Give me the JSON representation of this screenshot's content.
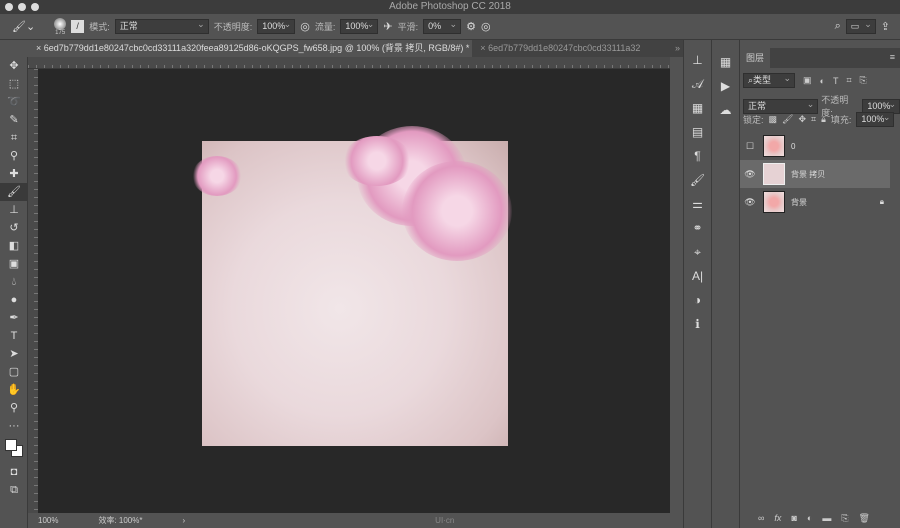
{
  "app": {
    "title": "Adobe Photoshop CC 2018"
  },
  "options": {
    "brush_size": "175",
    "mode_label": "模式:",
    "mode_value": "正常",
    "opacity_label": "不透明度:",
    "opacity_value": "100%",
    "flow_label": "流量:",
    "flow_value": "100%",
    "smoothing_label": "平滑:",
    "smoothing_value": "0%"
  },
  "tabs": [
    {
      "label": "6ed7b779dd1e80247cbc0cd33111a320feea89125d86-oKQGPS_fw658.jpg @ 100% (背景 拷贝, RGB/8#) *"
    },
    {
      "label": "6ed7b779dd1e80247cbc0cd33111a32"
    }
  ],
  "status": {
    "zoom": "100%",
    "efficiency": "效率: 100%*",
    "watermark": "UI·cn"
  },
  "layers_panel": {
    "tab": "图层",
    "filter": "类型",
    "blend_mode": "正常",
    "opacity_label": "不透明度:",
    "opacity_value": "100%",
    "lock_label": "锁定:",
    "fill_label": "填充:",
    "fill_value": "100%",
    "layers": [
      {
        "name": "0",
        "visible": false
      },
      {
        "name": "背景 拷贝",
        "visible": true,
        "selected": true
      },
      {
        "name": "背景",
        "visible": true,
        "locked": true
      }
    ]
  }
}
